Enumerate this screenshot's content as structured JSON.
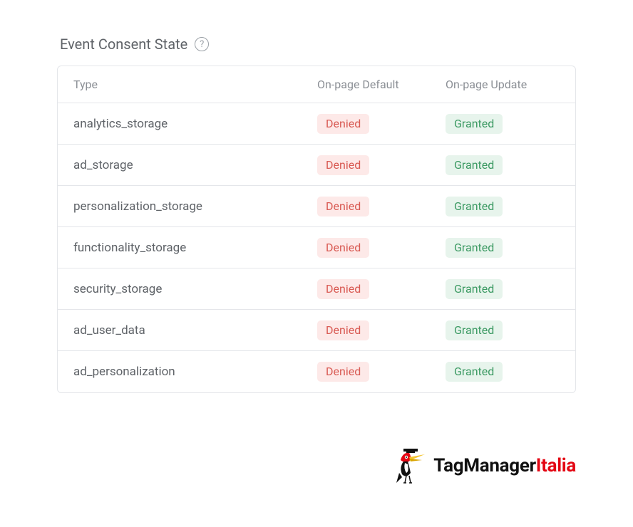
{
  "header": {
    "title": "Event Consent State"
  },
  "columns": {
    "type": "Type",
    "default": "On-page Default",
    "update": "On-page Update"
  },
  "badges": {
    "denied": "Denied",
    "granted": "Granted"
  },
  "rows": [
    {
      "type": "analytics_storage",
      "default": "denied",
      "update": "granted"
    },
    {
      "type": "ad_storage",
      "default": "denied",
      "update": "granted"
    },
    {
      "type": "personalization_storage",
      "default": "denied",
      "update": "granted"
    },
    {
      "type": "functionality_storage",
      "default": "denied",
      "update": "granted"
    },
    {
      "type": "security_storage",
      "default": "denied",
      "update": "granted"
    },
    {
      "type": "ad_user_data",
      "default": "denied",
      "update": "granted"
    },
    {
      "type": "ad_personalization",
      "default": "denied",
      "update": "granted"
    }
  ],
  "brand": {
    "part1": "TagManager",
    "part2": "Italia"
  }
}
